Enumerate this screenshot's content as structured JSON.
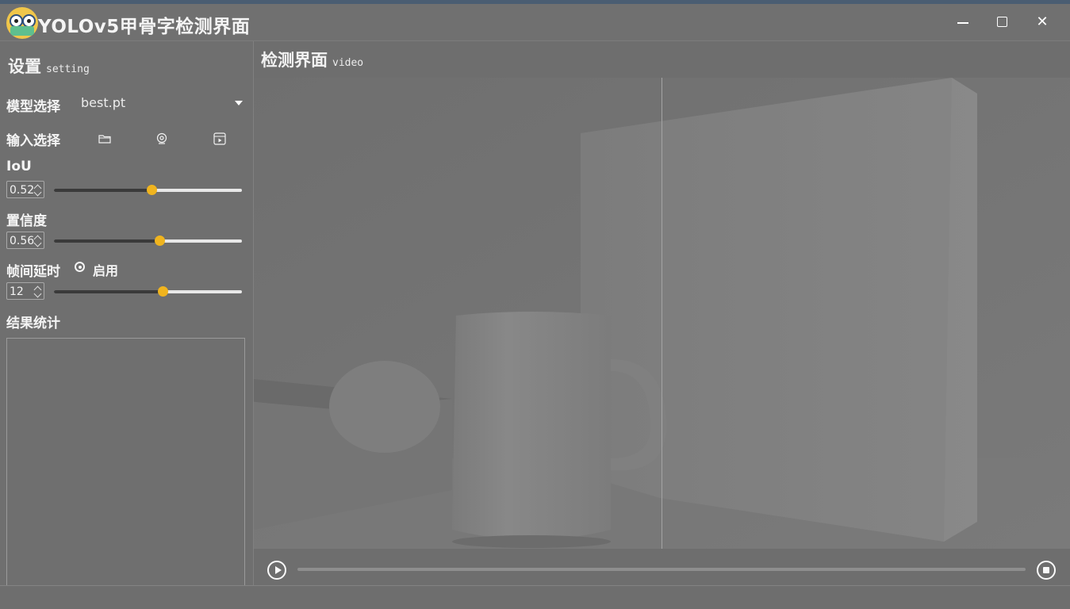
{
  "window": {
    "title": "YOLOv5甲骨字检测界面",
    "controls": {
      "minimize": "—",
      "close": "✕"
    }
  },
  "sidebar": {
    "title": "设置",
    "subtitle": "setting",
    "model_label": "模型选择",
    "model_value": "best.pt",
    "input_label": "输入选择",
    "input_icons": [
      "folder-icon",
      "webcam-icon",
      "video-file-icon"
    ],
    "iou_label": "IoU",
    "iou_value": "0.52",
    "iou_fraction": 0.52,
    "conf_label": "置信度",
    "conf_value": "0.56",
    "conf_fraction": 0.56,
    "delay_label": "帧间延时",
    "delay_enable_label": "启用",
    "delay_value": "12",
    "delay_fraction": 0.58,
    "results_label": "结果统计"
  },
  "main": {
    "title": "检测界面",
    "subtitle": "video",
    "progress_fraction": 0.0
  },
  "colors": {
    "accent": "#f0b41e",
    "background": "#6e6e6e"
  }
}
